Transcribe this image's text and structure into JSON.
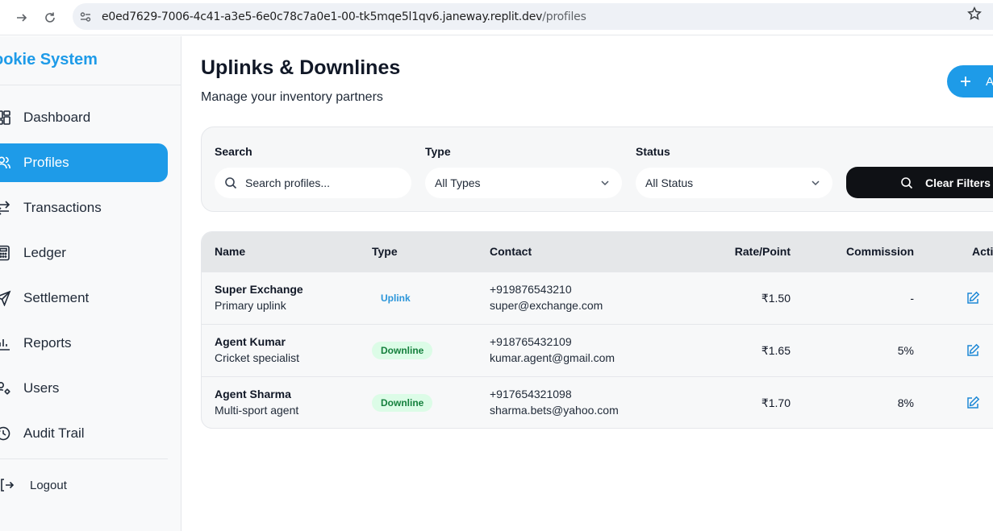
{
  "browser": {
    "url_host": "e0ed7629-7006-4c41-a3e5-6e0c78c7a0e1-00-tk5mqe5l1qv6.janeway.replit.dev",
    "url_path": "/profiles"
  },
  "sidebar": {
    "brand": "ookie System",
    "items": [
      {
        "label": "Dashboard",
        "icon": "dashboard-icon"
      },
      {
        "label": "Profiles",
        "icon": "users-icon",
        "active": true
      },
      {
        "label": "Transactions",
        "icon": "arrows-left-right-icon"
      },
      {
        "label": "Ledger",
        "icon": "calculator-icon"
      },
      {
        "label": "Settlement",
        "icon": "send-icon"
      },
      {
        "label": "Reports",
        "icon": "bar-chart-icon"
      },
      {
        "label": "Users",
        "icon": "user-cog-icon"
      },
      {
        "label": "Audit Trail",
        "icon": "history-icon"
      }
    ],
    "logout_label": "Logout"
  },
  "main": {
    "title": "Uplinks & Downlines",
    "subtitle": "Manage your inventory partners",
    "add_button_label": "A"
  },
  "filters": {
    "search_label": "Search",
    "search_placeholder": "Search profiles...",
    "type_label": "Type",
    "type_value": "All Types",
    "status_label": "Status",
    "status_value": "All Status",
    "clear_label": "Clear Filters"
  },
  "table": {
    "headers": [
      "Name",
      "Type",
      "Contact",
      "Rate/Point",
      "Commission",
      "Actio"
    ],
    "rows": [
      {
        "name": "Super Exchange",
        "description": "Primary uplink",
        "type": "Uplink",
        "phone": "+919876543210",
        "email": "super@exchange.com",
        "rate": "₹1.50",
        "commission": "-"
      },
      {
        "name": "Agent Kumar",
        "description": "Cricket specialist",
        "type": "Downline",
        "phone": "+918765432109",
        "email": "kumar.agent@gmail.com",
        "rate": "₹1.65",
        "commission": "5%"
      },
      {
        "name": "Agent Sharma",
        "description": "Multi-sport agent",
        "type": "Downline",
        "phone": "+917654321098",
        "email": "sharma.bets@yahoo.com",
        "rate": "₹1.70",
        "commission": "8%"
      }
    ]
  },
  "colors": {
    "accent": "#1e9be8",
    "uplink_text": "#2a95d9",
    "downline_text": "#15803d",
    "downline_bg": "#dcfce7",
    "clear_button_bg": "#0f1115"
  }
}
